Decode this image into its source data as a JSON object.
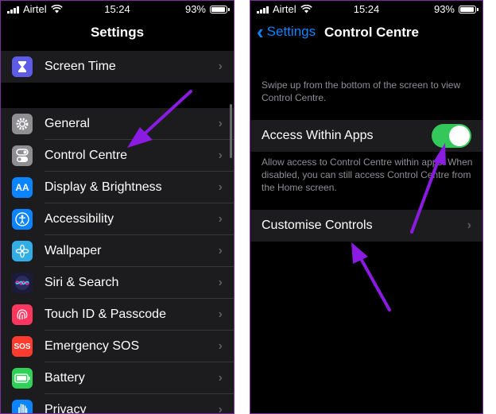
{
  "status_left": {
    "carrier": "Airtel",
    "time": "15:24",
    "battery": "93%",
    "battery_level": 0.93
  },
  "status_right": {
    "carrier": "Airtel",
    "time": "15:24",
    "battery": "93%",
    "battery_level": 0.93
  },
  "left_screen": {
    "title": "Settings",
    "top_group": [
      {
        "label": "Screen Time",
        "icon": "hourglass-icon",
        "color": "#5e5ce6"
      }
    ],
    "main_group": [
      {
        "label": "General",
        "icon": "gear-icon",
        "color": "#8e8e93"
      },
      {
        "label": "Control Centre",
        "icon": "toggles-icon",
        "color": "#8e8e93"
      },
      {
        "label": "Display & Brightness",
        "icon": "text-size-icon",
        "color": "#0a84ff",
        "glyph": "AA"
      },
      {
        "label": "Accessibility",
        "icon": "accessibility-icon",
        "color": "#0a84ff"
      },
      {
        "label": "Wallpaper",
        "icon": "flower-icon",
        "color": "#32ade6"
      },
      {
        "label": "Siri & Search",
        "icon": "siri-icon",
        "color": "#2c2c5e"
      },
      {
        "label": "Touch ID & Passcode",
        "icon": "fingerprint-icon",
        "color": "#ff375f"
      },
      {
        "label": "Emergency SOS",
        "icon": "sos-icon",
        "color": "#ff3b30",
        "glyph": "SOS"
      },
      {
        "label": "Battery",
        "icon": "battery-icon",
        "color": "#30d158"
      },
      {
        "label": "Privacy",
        "icon": "hand-icon",
        "color": "#0a84ff"
      }
    ]
  },
  "right_screen": {
    "back_label": "Settings",
    "title": "Control Centre",
    "intro_text": "Swipe up from the bottom of the screen to view Control Centre.",
    "access_label": "Access Within Apps",
    "access_enabled": true,
    "access_footer": "Allow access to Control Centre within apps. When disabled, you can still access Control Centre from the Home screen.",
    "customise_label": "Customise Controls"
  },
  "colors": {
    "accent": "#0a84ff",
    "toggle_on": "#34c759",
    "annotation_arrow": "#8a1be0"
  }
}
